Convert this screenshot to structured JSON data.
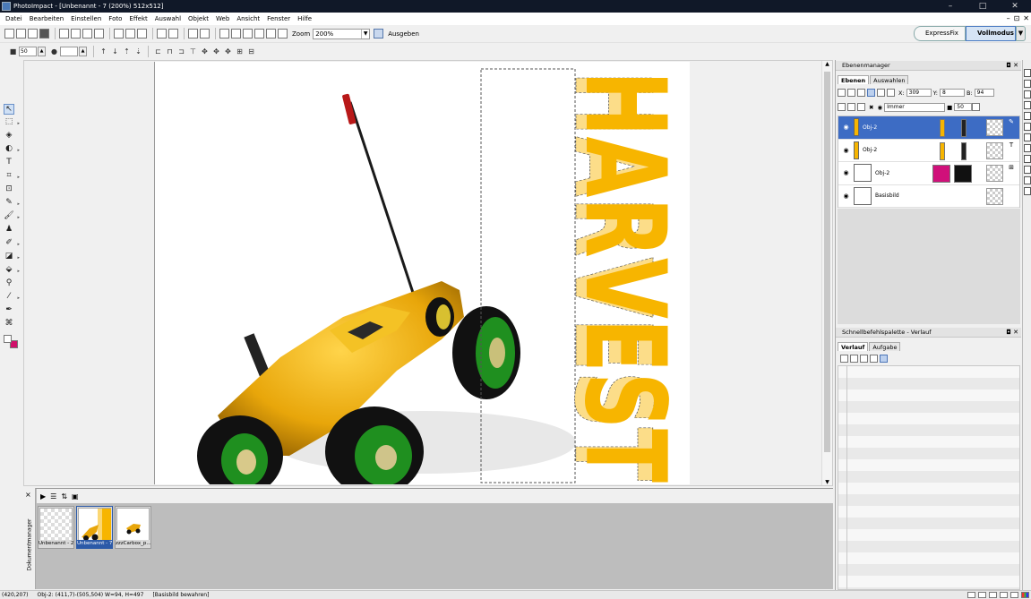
{
  "window": {
    "title": "PhotoImpact - [Unbenannt - 7 (200%) 512x512]",
    "controls": [
      "–",
      "□",
      "✕"
    ],
    "mdi_controls": [
      "–",
      "⊡",
      "✕"
    ]
  },
  "menu": [
    "Datei",
    "Bearbeiten",
    "Einstellen",
    "Foto",
    "Effekt",
    "Auswahl",
    "Objekt",
    "Web",
    "Ansicht",
    "Fenster",
    "Hilfe"
  ],
  "toolbar": {
    "zoom_label": "Zoom",
    "zoom_value": "200%",
    "output_label": "Ausgeben"
  },
  "mode": {
    "expressfix": "ExpressFix",
    "vollmodus": "Vollmodus"
  },
  "attr_bar": {
    "size_value": "50"
  },
  "canvas": {
    "text_solid": "HARVEST",
    "text_selected": "HARVEST",
    "colors": {
      "text": "#f7b500",
      "selected_text": "#fbd774",
      "car_body": "#e8a60a",
      "wheel_rim": "#1f8f1f"
    }
  },
  "document_manager": {
    "label": "Dokumentmanager",
    "thumbnails": [
      {
        "caption": "Unbenannt - 2",
        "selected": false
      },
      {
        "caption": "Unbenannt - 7",
        "selected": true
      },
      {
        "caption": "zzzCarbox_p...",
        "selected": false
      }
    ]
  },
  "layer_manager": {
    "title": "Ebenenmanager",
    "tabs": [
      "Ebenen",
      "Auswahlen"
    ],
    "x_label": "X:",
    "x_value": "309",
    "y_label": "Y:",
    "y_value": "8",
    "b_label": "B:",
    "b_value": "94",
    "merge_mode": "Immer",
    "opacity_value": "50",
    "layers": [
      {
        "name": "Obj-2",
        "selected": true
      },
      {
        "name": "Obj-2",
        "selected": false
      },
      {
        "name": "Obj-2",
        "selected": false
      },
      {
        "name": "Basisbild",
        "selected": false
      }
    ]
  },
  "quick_palette": {
    "title": "Schnellbefehlspalette - Verlauf",
    "tabs": [
      "Verlauf",
      "Aufgabe"
    ]
  },
  "status": {
    "coords": "(420,207)",
    "object_info": "Obj-2: (411,7)-(505,504) W=94, H=497",
    "hint": "[Basisbild bewahren]"
  }
}
